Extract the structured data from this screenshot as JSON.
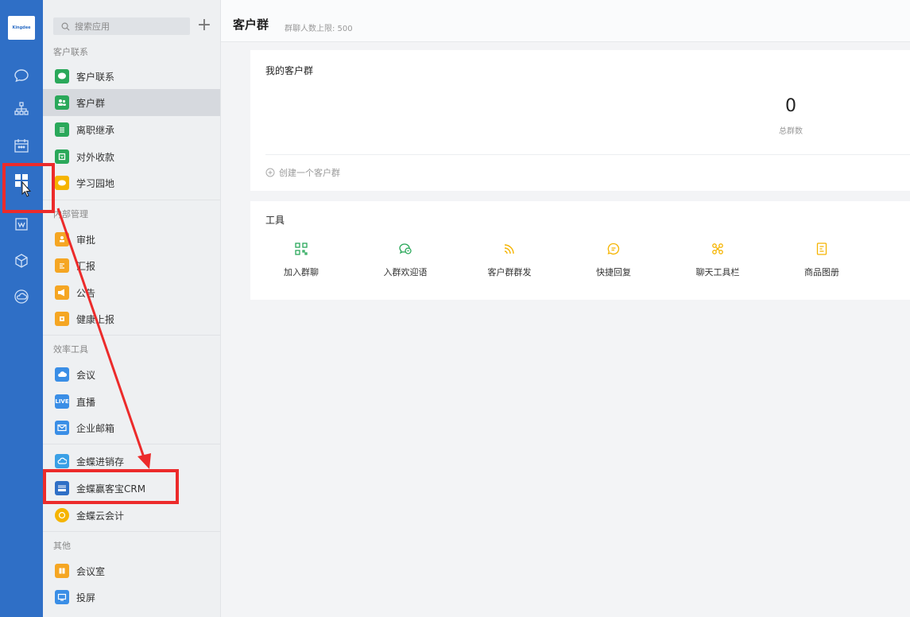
{
  "rail": {
    "logo_text": "Kingdee",
    "icons": [
      "chat-icon",
      "org-chart-icon",
      "calendar-icon",
      "apps-grid-icon",
      "doc-w-icon",
      "box-icon",
      "cloud-icon"
    ]
  },
  "sidebar": {
    "search_placeholder": "搜索应用",
    "add_label": "+",
    "sections": [
      {
        "title": "客户联系",
        "items": [
          {
            "label": "客户联系",
            "icon": "chat-bubble-icon",
            "color": "#2aa85a"
          },
          {
            "label": "客户群",
            "icon": "group-icon",
            "color": "#2aa85a",
            "active": true
          },
          {
            "label": "离职继承",
            "icon": "document-icon",
            "color": "#2aa85a"
          },
          {
            "label": "对外收款",
            "icon": "receipt-icon",
            "color": "#2aa85a"
          },
          {
            "label": "学习园地",
            "icon": "book-icon",
            "color": "#f5b400"
          }
        ]
      },
      {
        "title": "内部管理",
        "items": [
          {
            "label": "审批",
            "icon": "stamp-icon",
            "color": "#f5a623"
          },
          {
            "label": "汇报",
            "icon": "report-icon",
            "color": "#f5a623"
          },
          {
            "label": "公告",
            "icon": "megaphone-icon",
            "color": "#f5a623"
          },
          {
            "label": "健康上报",
            "icon": "health-icon",
            "color": "#f5a623"
          }
        ]
      },
      {
        "title": "效率工具",
        "items": [
          {
            "label": "会议",
            "icon": "cloud-meeting-icon",
            "color": "#3a8ee6"
          },
          {
            "label": "直播",
            "icon": "live-icon",
            "color": "#3a8ee6",
            "glyph": "LIVE"
          },
          {
            "label": "企业邮箱",
            "icon": "mail-icon",
            "color": "#3a8ee6"
          }
        ]
      },
      {
        "title": "",
        "items": [
          {
            "label": "金蝶进销存",
            "icon": "kingdee-inventory-icon",
            "color": "#3aa0e6"
          },
          {
            "label": "金蝶赢客宝CRM",
            "icon": "kingdee-crm-icon",
            "color": "#2f6fc6"
          },
          {
            "label": "金蝶云会计",
            "icon": "kingdee-accounting-icon",
            "color": "#f5b400"
          }
        ]
      },
      {
        "title": "其他",
        "items": [
          {
            "label": "会议室",
            "icon": "meeting-room-icon",
            "color": "#f5a623"
          },
          {
            "label": "投屏",
            "icon": "screen-cast-icon",
            "color": "#3a8ee6"
          }
        ]
      }
    ]
  },
  "header": {
    "title": "客户群",
    "subtitle": "群聊人数上限: 500"
  },
  "my_groups": {
    "title": "我的客户群",
    "count": "0",
    "count_label": "总群数",
    "create_label": "创建一个客户群"
  },
  "tools": {
    "title": "工具",
    "items": [
      {
        "label": "加入群聊",
        "icon": "qr-code-icon",
        "color": "#2aa85a"
      },
      {
        "label": "入群欢迎语",
        "icon": "welcome-chat-icon",
        "color": "#2aa85a"
      },
      {
        "label": "客户群群发",
        "icon": "broadcast-icon",
        "color": "#f5b400"
      },
      {
        "label": "快捷回复",
        "icon": "quick-reply-icon",
        "color": "#f5b400"
      },
      {
        "label": "聊天工具栏",
        "icon": "toolbar-icon",
        "color": "#f5b400"
      },
      {
        "label": "商品图册",
        "icon": "catalog-icon",
        "color": "#f5b400"
      }
    ]
  }
}
